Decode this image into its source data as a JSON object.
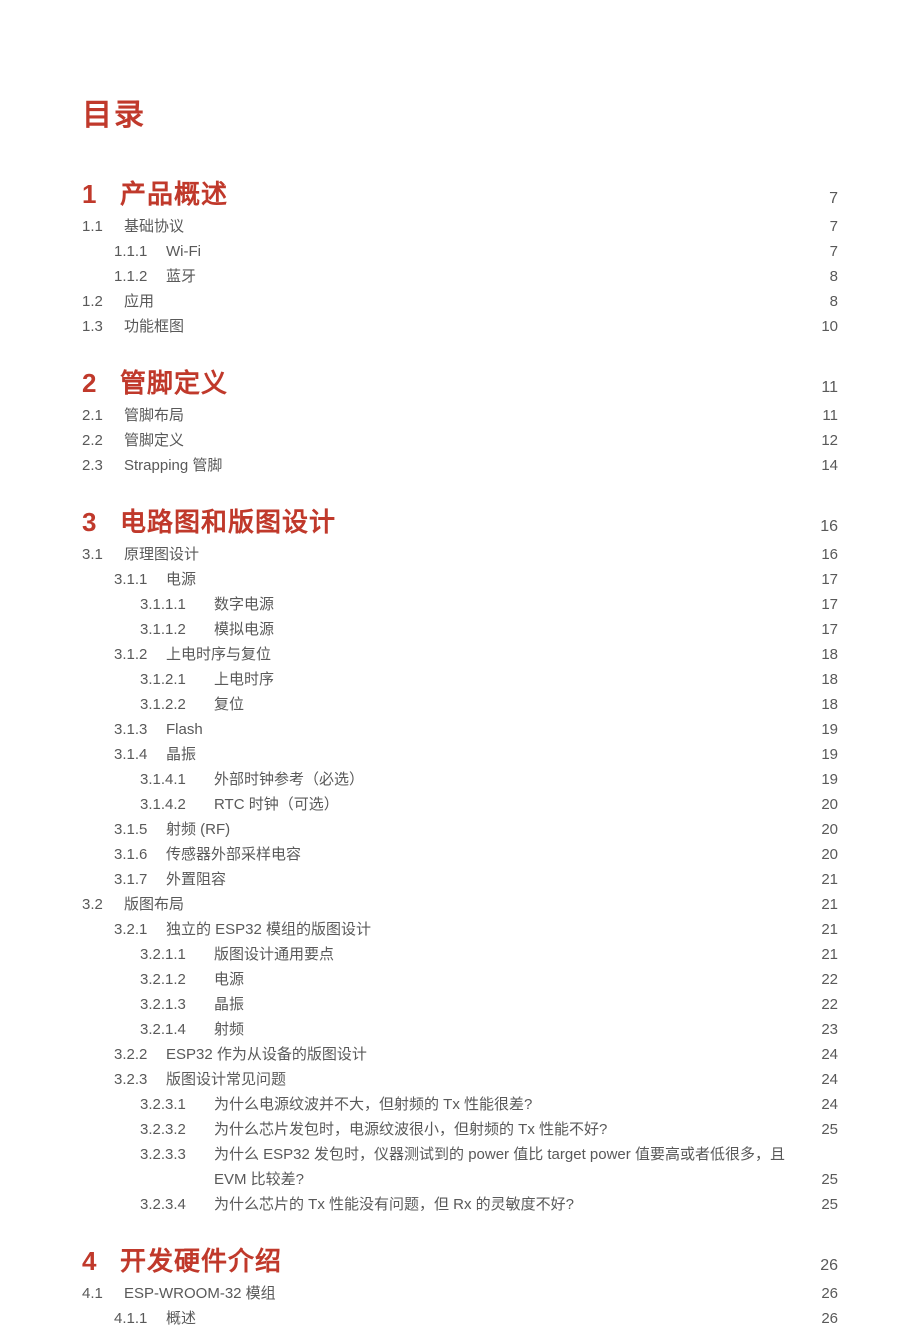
{
  "title": "目录",
  "chapters": [
    {
      "num": "1",
      "label": "产品概述",
      "page": "7",
      "sections": [
        {
          "num": "1.1",
          "label": "基础协议",
          "page": "7",
          "level": 1
        },
        {
          "num": "1.1.1",
          "label": "Wi-Fi",
          "page": "7",
          "level": 2
        },
        {
          "num": "1.1.2",
          "label": "蓝牙",
          "page": "8",
          "level": 2
        },
        {
          "num": "1.2",
          "label": "应用",
          "page": "8",
          "level": 1
        },
        {
          "num": "1.3",
          "label": "功能框图",
          "page": "10",
          "level": 1
        }
      ]
    },
    {
      "num": "2",
      "label": "管脚定义",
      "page": "11",
      "sections": [
        {
          "num": "2.1",
          "label": "管脚布局",
          "page": "11",
          "level": 1
        },
        {
          "num": "2.2",
          "label": "管脚定义",
          "page": "12",
          "level": 1
        },
        {
          "num": "2.3",
          "label": "Strapping 管脚",
          "page": "14",
          "level": 1
        }
      ]
    },
    {
      "num": "3",
      "label": "电路图和版图设计",
      "page": "16",
      "sections": [
        {
          "num": "3.1",
          "label": "原理图设计",
          "page": "16",
          "level": 1
        },
        {
          "num": "3.1.1",
          "label": "电源",
          "page": "17",
          "level": 2
        },
        {
          "num": "3.1.1.1",
          "label": "数字电源",
          "page": "17",
          "level": 3
        },
        {
          "num": "3.1.1.2",
          "label": "模拟电源",
          "page": "17",
          "level": 3
        },
        {
          "num": "3.1.2",
          "label": "上电时序与复位",
          "page": "18",
          "level": 2
        },
        {
          "num": "3.1.2.1",
          "label": "上电时序",
          "page": "18",
          "level": 3
        },
        {
          "num": "3.1.2.2",
          "label": "复位",
          "page": "18",
          "level": 3
        },
        {
          "num": "3.1.3",
          "label": "Flash",
          "page": "19",
          "level": 2
        },
        {
          "num": "3.1.4",
          "label": "晶振",
          "page": "19",
          "level": 2
        },
        {
          "num": "3.1.4.1",
          "label": "外部时钟参考（必选）",
          "page": "19",
          "level": 3
        },
        {
          "num": "3.1.4.2",
          "label": "RTC 时钟（可选）",
          "page": "20",
          "level": 3
        },
        {
          "num": "3.1.5",
          "label": "射频 (RF)",
          "page": "20",
          "level": 2
        },
        {
          "num": "3.1.6",
          "label": "传感器外部采样电容",
          "page": "20",
          "level": 2
        },
        {
          "num": "3.1.7",
          "label": "外置阻容",
          "page": "21",
          "level": 2
        },
        {
          "num": "3.2",
          "label": "版图布局",
          "page": "21",
          "level": 1
        },
        {
          "num": "3.2.1",
          "label": "独立的 ESP32 模组的版图设计",
          "page": "21",
          "level": 2
        },
        {
          "num": "3.2.1.1",
          "label": "版图设计通用要点",
          "page": "21",
          "level": 3
        },
        {
          "num": "3.2.1.2",
          "label": "电源",
          "page": "22",
          "level": 3
        },
        {
          "num": "3.2.1.3",
          "label": "晶振",
          "page": "22",
          "level": 3
        },
        {
          "num": "3.2.1.4",
          "label": "射频",
          "page": "23",
          "level": 3
        },
        {
          "num": "3.2.2",
          "label": "ESP32 作为从设备的版图设计",
          "page": "24",
          "level": 2
        },
        {
          "num": "3.2.3",
          "label": "版图设计常见问题",
          "page": "24",
          "level": 2
        },
        {
          "num": "3.2.3.1",
          "label": "为什么电源纹波并不大，但射频的 Tx 性能很差?",
          "page": "24",
          "level": 3
        },
        {
          "num": "3.2.3.2",
          "label": "为什么芯片发包时，电源纹波很小，但射频的 Tx 性能不好?",
          "page": "25",
          "level": 3
        },
        {
          "num": "3.2.3.3",
          "label": "为什么 ESP32 发包时，仪器测试到的 power 值比 target power 值要高或者低很多，且",
          "label2": "EVM 比较差?",
          "page": "25",
          "level": 3,
          "wrap": true
        },
        {
          "num": "3.2.3.4",
          "label": "为什么芯片的 Tx 性能没有问题，但 Rx 的灵敏度不好?",
          "page": "25",
          "level": 3
        }
      ]
    },
    {
      "num": "4",
      "label": "开发硬件介绍",
      "page": "26",
      "sections": [
        {
          "num": "4.1",
          "label": "ESP-WROOM-32 模组",
          "page": "26",
          "level": 1
        },
        {
          "num": "4.1.1",
          "label": "概述",
          "page": "26",
          "level": 2
        }
      ]
    }
  ]
}
